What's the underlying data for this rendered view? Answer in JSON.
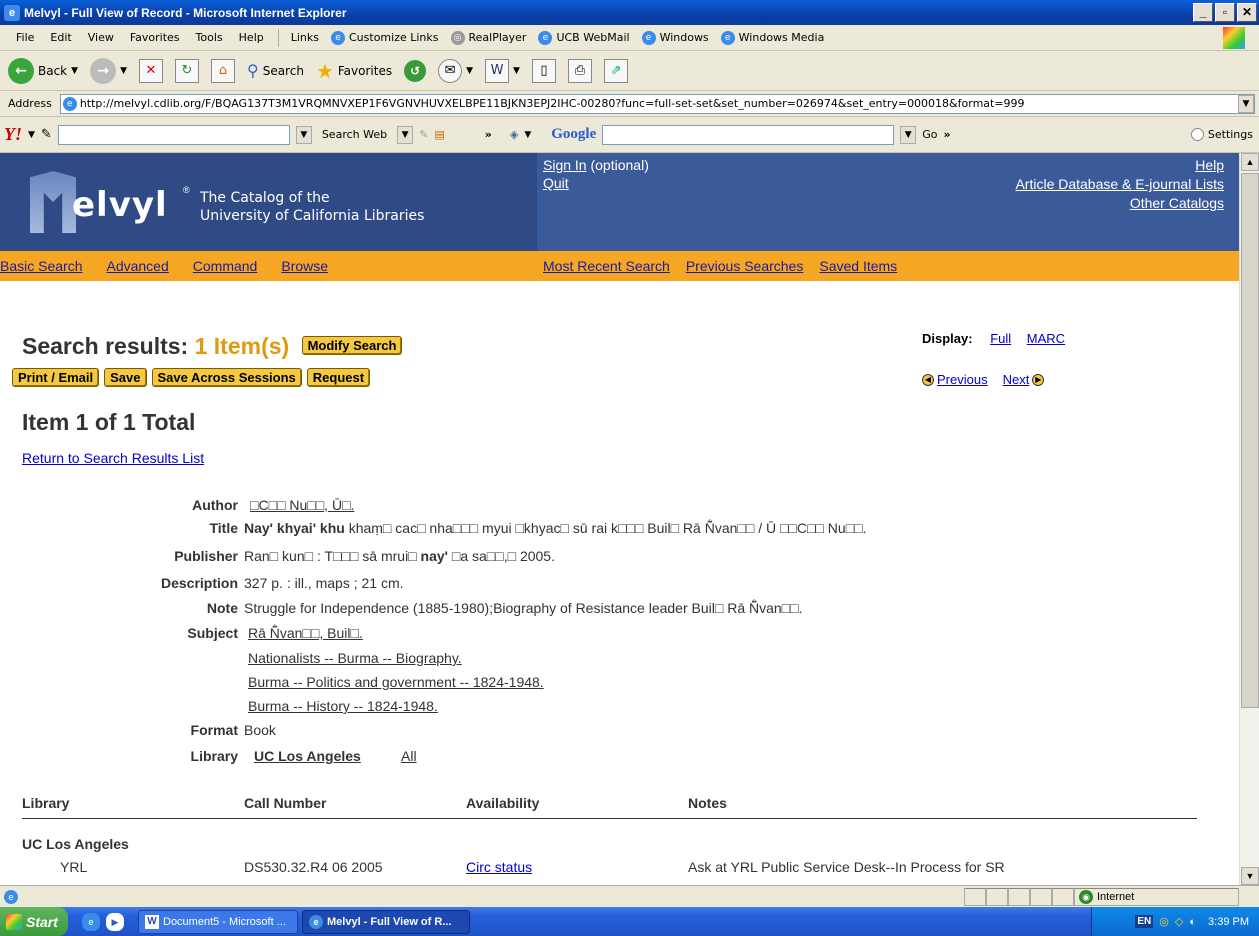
{
  "window": {
    "title": "Melvyl - Full View of Record - Microsoft Internet Explorer"
  },
  "menubar": {
    "items": [
      "File",
      "Edit",
      "View",
      "Favorites",
      "Tools",
      "Help"
    ],
    "links_label": "Links",
    "links": [
      "Customize Links",
      "RealPlayer",
      "UCB WebMail",
      "Windows",
      "Windows Media"
    ]
  },
  "toolbar": {
    "back": "Back",
    "search": "Search",
    "favorites": "Favorites"
  },
  "address": {
    "label": "Address",
    "url": "http://melvyl.cdlib.org/F/BQAG137T3M1VRQMNVXEP1F6VGNVHUVXELBPE11BJKN3EPJ2IHC-00280?func=full-set-set&set_number=026974&set_entry=000018&format=999"
  },
  "yahoo_toolbar": {
    "search_web": "Search Web",
    "google": "Google",
    "go": "Go",
    "settings": "Settings"
  },
  "header": {
    "logo_text": "elvyl",
    "registered": "®",
    "tagline_1": "The Catalog of the",
    "tagline_2": "University of California Libraries",
    "sign_in": "Sign In",
    "sign_in_note": "(optional)",
    "quit": "Quit",
    "help": "Help",
    "article_db": "Article Database & E-journal Lists",
    "other_catalogs": "Other Catalogs"
  },
  "nav": {
    "left": [
      "Basic Search",
      "Advanced",
      "Command",
      "Browse"
    ],
    "right": [
      "Most Recent Search",
      "Previous Searches",
      "Saved Items"
    ]
  },
  "results": {
    "title": "Search results:",
    "count": "1 Item(s)",
    "modify": "Modify Search",
    "buttons": [
      "Print / Email",
      "Save",
      "Save Across Sessions",
      "Request"
    ],
    "display_label": "Display:",
    "display_full": "Full",
    "display_marc": "MARC",
    "previous": "Previous",
    "next": "Next",
    "item_heading": "Item 1 of 1 Total",
    "return_link": "Return to Search Results List"
  },
  "record": {
    "author_label": "Author",
    "author": "□C□□ Nu□□, Ū□.",
    "title_label": "Title",
    "title_bold": "Nay' khyai' khu",
    "title_rest": " khaṃ□ cac□ nha□□□ myui □khyac□ sū rai k□□□ Buil□ Rā Ñ̐van□□ / Ū □□C□□ Nu□□.",
    "publisher_label": "Publisher",
    "publisher_a": "Ran□ kun□ : T□□□ sā mrui□ ",
    "publisher_bold": "nay'",
    "publisher_b": " □a sa□□,□ 2005.",
    "description_label": "Description",
    "description": "327 p. : ill., maps ; 21 cm.",
    "note_label": "Note",
    "note": "Struggle for Independence (1885-1980);Biography of Resistance leader Buil□ Rā Ñ̐van□□.",
    "subject_label": "Subject",
    "subjects": [
      "Rā Ñ̐van□□, Buil□.",
      "Nationalists -- Burma -- Biography.",
      "Burma -- Politics and government -- 1824-1948.",
      "Burma -- History -- 1824-1948."
    ],
    "format_label": "Format",
    "format": "Book",
    "library_label": "Library",
    "library": "UC Los Angeles",
    "library_all": "All"
  },
  "holdings": {
    "headers": [
      "Library",
      "Call Number",
      "Availability",
      "Notes"
    ],
    "group": "UC Los Angeles",
    "rows": [
      {
        "location": "YRL",
        "call_number": "DS530.32.R4 06 2005",
        "availability": "Circ status",
        "notes": "Ask at YRL Public Service Desk--In Process for SR"
      }
    ]
  },
  "statusbar": {
    "zone": "Internet"
  },
  "taskbar": {
    "start": "Start",
    "tasks": [
      "Document5 - Microsoft ...",
      "Melvyl - Full View of R..."
    ],
    "lang": "EN",
    "clock": "3:39 PM"
  }
}
